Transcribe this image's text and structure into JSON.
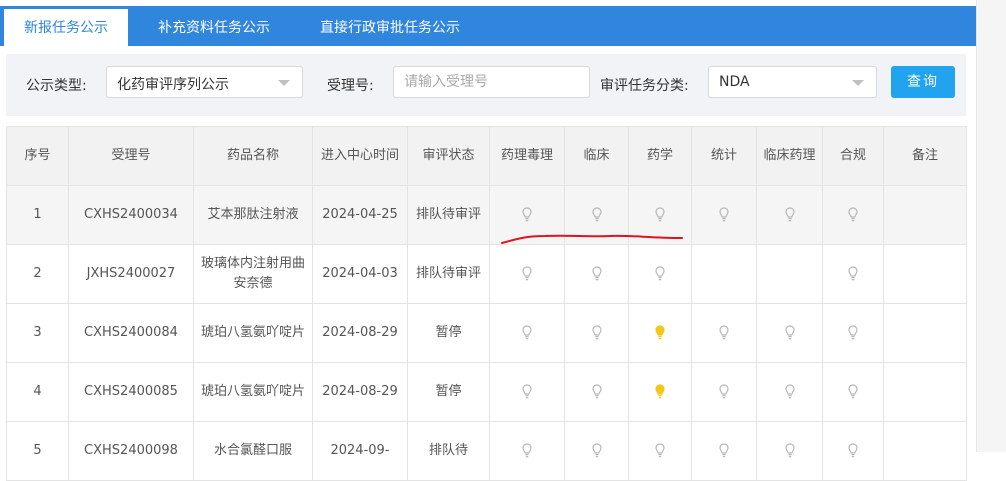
{
  "tabs": [
    {
      "label": "新报任务公示",
      "active": true
    },
    {
      "label": "补充资料任务公示",
      "active": false
    },
    {
      "label": "直接行政审批任务公示",
      "active": false
    }
  ],
  "filters": {
    "type_label": "公示类型:",
    "type_value": "化药审评序列公示",
    "accept_label": "受理号:",
    "accept_placeholder": "请输入受理号",
    "category_label": "审评任务分类:",
    "category_value": "NDA",
    "query_label": "查询"
  },
  "columns": [
    "序号",
    "受理号",
    "药品名称",
    "进入中心时间",
    "审评状态",
    "药理毒理",
    "临床",
    "药学",
    "统计",
    "临床药理",
    "合规",
    "备注"
  ],
  "rows": [
    {
      "no": "1",
      "accept_no": "CXHS2400034",
      "drug": "艾本那肽注射液",
      "date": "2024-04-25",
      "status": "排队待审评",
      "bulbs": [
        "off",
        "off",
        "off",
        "off",
        "off",
        "off"
      ],
      "note": ""
    },
    {
      "no": "2",
      "accept_no": "JXHS2400027",
      "drug": "玻璃体内注射用曲安奈德",
      "date": "2024-04-03",
      "status": "排队待审评",
      "bulbs": [
        "off",
        "off",
        "off",
        "",
        "",
        "off"
      ],
      "note": ""
    },
    {
      "no": "3",
      "accept_no": "CXHS2400084",
      "drug": "琥珀八氢氨吖啶片",
      "date": "2024-08-29",
      "status": "暂停",
      "bulbs": [
        "off",
        "off",
        "on",
        "off",
        "off",
        "off"
      ],
      "note": ""
    },
    {
      "no": "4",
      "accept_no": "CXHS2400085",
      "drug": "琥珀八氢氨吖啶片",
      "date": "2024-08-29",
      "status": "暂停",
      "bulbs": [
        "off",
        "off",
        "on",
        "off",
        "off",
        "off"
      ],
      "note": ""
    },
    {
      "no": "5",
      "accept_no": "CXHS2400098",
      "drug": "水合氯醛口服",
      "date": "2024-09-",
      "status": "排队待",
      "bulbs": [
        "off",
        "off",
        "off",
        "off",
        "off",
        "off"
      ],
      "note": ""
    }
  ],
  "colors": {
    "tab_bar": "#2f86dc",
    "button": "#22a3f0",
    "bulb_on": "#f5c518",
    "bulb_off": "#b8b8b8",
    "annotation": "#e0141e"
  },
  "icons": {
    "bulb": "lightbulb-icon",
    "caret": "chevron-down-icon",
    "annotation": "red-underline"
  }
}
